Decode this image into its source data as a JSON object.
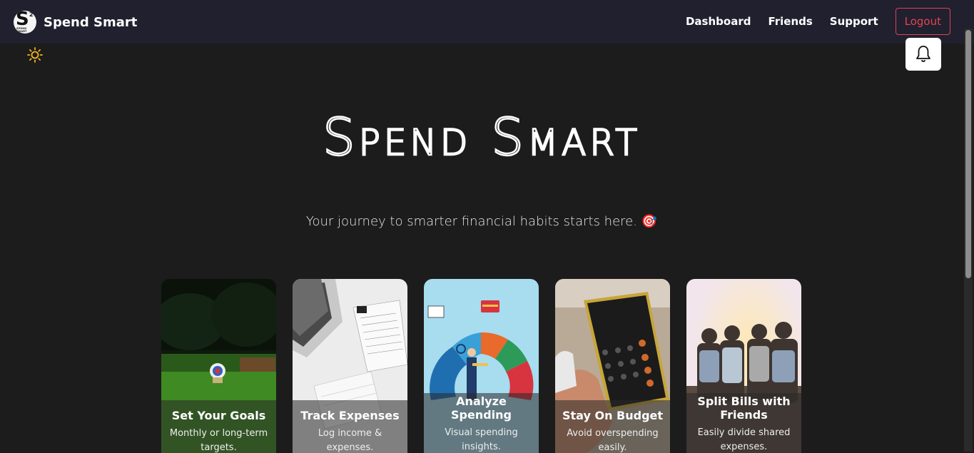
{
  "brand": {
    "name": "Spend Smart",
    "logo_letter": "S",
    "logo_sup": "2",
    "logo_sub": "SPEND SMART"
  },
  "nav": {
    "dashboard": "Dashboard",
    "friends": "Friends",
    "support": "Support",
    "logout": "Logout"
  },
  "icons": {
    "theme": "sun-icon",
    "notifications": "bell-icon"
  },
  "hero": {
    "title": "Spend Smart",
    "tagline": "Your journey to smarter financial habits starts here. 🎯"
  },
  "cards": [
    {
      "title": "Set Your Goals",
      "desc": "Monthly or long-term targets."
    },
    {
      "title": "Track Expenses",
      "desc": "Log income & expenses."
    },
    {
      "title": "Analyze Spending",
      "desc": "Visual spending insights."
    },
    {
      "title": "Stay On Budget",
      "desc": "Avoid overspending easily."
    },
    {
      "title": "Split Bills with Friends",
      "desc": "Easily divide shared expenses."
    }
  ],
  "colors": {
    "navbar": "#20202f",
    "background": "#1c1c1c",
    "logout": "#e2434f"
  }
}
